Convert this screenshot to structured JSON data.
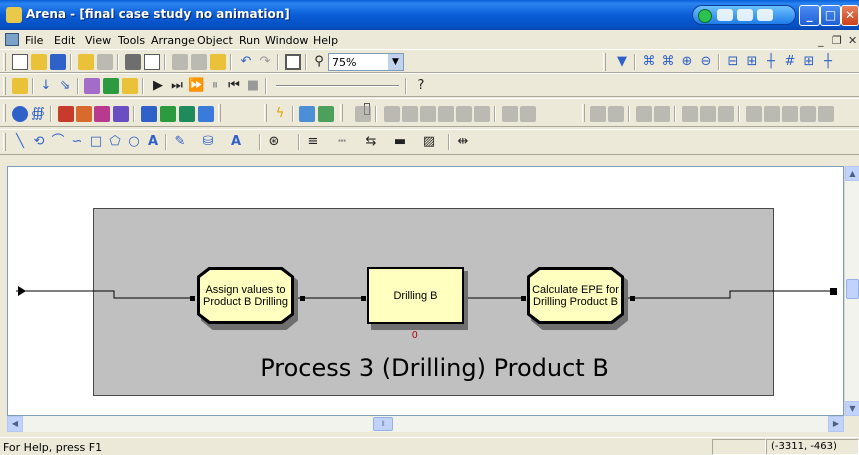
{
  "window": {
    "title": "Arena - [final case study no animation]",
    "controls": [
      "minimize-icon",
      "maximize-icon",
      "close-icon"
    ]
  },
  "menu": {
    "items": [
      "File",
      "Edit",
      "View",
      "Tools",
      "Arrange",
      "Object",
      "Run",
      "Window",
      "Help"
    ],
    "mdi_min": "_",
    "mdi_restore": "❐",
    "mdi_close": "✕"
  },
  "toolbar": {
    "zoom_value": "75%",
    "help_glyph": "?"
  },
  "canvas": {
    "panel_title": "Process 3 (Drilling) Product B",
    "modules": [
      {
        "type": "assign",
        "label": "Assign values to Product B Drilling"
      },
      {
        "type": "process",
        "label": "Drilling B",
        "counter": "0"
      },
      {
        "type": "assign",
        "label": "Calculate EPE for Drilling Product B"
      }
    ]
  },
  "status": {
    "help_text": "For Help, press F1",
    "coords": "(-3311, -463)"
  },
  "colors": {
    "module_fill": "#FFFFC0",
    "panel_fill": "#C0C0C0",
    "counter": "#B30000"
  }
}
